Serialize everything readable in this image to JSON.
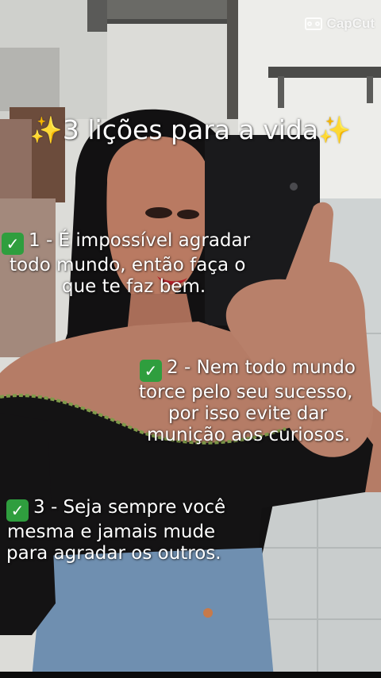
{
  "watermark": {
    "label": "CapCut",
    "icon": "capcut-logo-icon"
  },
  "title": {
    "sparkle_left": "✨",
    "text": "3 lições para a vida",
    "sparkle_right": "✨"
  },
  "lessons": [
    {
      "icon": "check-mark-button-icon",
      "lines": [
        "1 - É impossível agradar",
        "todo mundo, então faça o",
        "que te faz bem."
      ]
    },
    {
      "icon": "check-mark-button-icon",
      "lines": [
        "2 - Nem todo mundo",
        "torce pelo seu sucesso,",
        "por isso evite dar",
        "munição aos curiosos."
      ]
    },
    {
      "icon": "check-mark-button-icon",
      "lines": [
        "3 - Seja sempre você",
        "mesma e jamais mude",
        "para agradar os outros."
      ]
    }
  ],
  "colors": {
    "text": "#ffffff",
    "sparkle": "#f7c61a",
    "check_badge": "#2f9e3e"
  }
}
